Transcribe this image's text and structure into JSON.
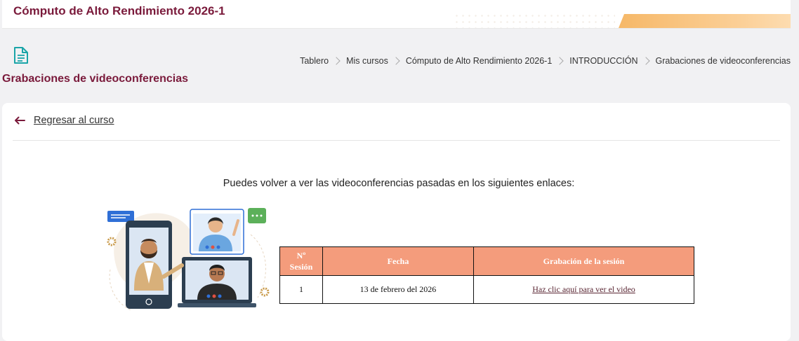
{
  "header": {
    "course_title": "Cómputo de Alto Rendimiento 2026-1"
  },
  "page": {
    "title": "Grabaciones de videoconferencias",
    "icon": "document-icon",
    "colors": {
      "brand": "#7a1a3b",
      "table_header": "#f49c7c",
      "accent_stripe": "#f6b868"
    }
  },
  "breadcrumb": {
    "items": [
      "Tablero",
      "Mis cursos",
      "Cómputo de Alto Rendimiento 2026-1",
      "INTRODUCCIÓN",
      "Grabaciones de videoconferencias"
    ]
  },
  "back_link": {
    "label": "Regresar al curso",
    "icon": "arrow-left-icon"
  },
  "intro_text": "Puedes volver a ver las videoconferencias pasadas en los siguientes enlaces:",
  "table": {
    "headers": [
      "Nº Sesión",
      "Fecha",
      "Grabación de la sesión"
    ],
    "rows": [
      {
        "session": "1",
        "date": "13 de febrero del 2026",
        "link": "Haz clic aquí para ver el video"
      }
    ]
  }
}
